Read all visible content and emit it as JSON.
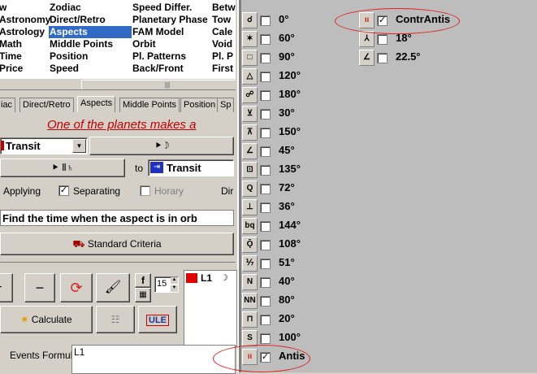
{
  "categories": {
    "col1": [
      "w",
      "Astronomy",
      "Astrology",
      "Math",
      "Time",
      "Price"
    ],
    "col2": [
      "Zodiac",
      "Direct/Retro",
      "Aspects",
      "Middle Points",
      "Position",
      "Speed"
    ],
    "col3": [
      "Speed Differ.",
      "Planetary Phase",
      "FAM Model",
      "Orbit",
      "Pl. Patterns",
      "Back/Front"
    ],
    "col4": [
      "Betw",
      "Tow",
      "Cale",
      "Void",
      "Pl. P",
      "First"
    ],
    "selected": "Aspects"
  },
  "tabs": [
    "iac",
    "Direct/Retro",
    "Aspects",
    "Middle Points",
    "Position",
    "Sp"
  ],
  "active_tab": "Aspects",
  "banner": "One of the planets makes a",
  "transit_left": "Transit",
  "planet_btn": "⯈ Ⅱ♄",
  "to_label": "to",
  "transit_right": "Transit",
  "moon_btn": "⯈☽",
  "options": {
    "applying": "Applying",
    "separating": "Separating",
    "horary": "Horary",
    "dir": "Dir"
  },
  "criteria_text": "Find the time when the aspect is in orb",
  "standard_criteria": "Standard Criteria",
  "spin_value": "15",
  "f_label": "f",
  "calculate_label": "Calculate",
  "ule_label": "ULE",
  "l1_label": "L1",
  "events_label": "Events Formula",
  "events_value": "L1",
  "aspects_left": [
    {
      "icon": "☌",
      "label": "0°",
      "checked": false
    },
    {
      "icon": "✶",
      "label": "60°",
      "checked": false
    },
    {
      "icon": "□",
      "label": "90°",
      "checked": false
    },
    {
      "icon": "△",
      "label": "120°",
      "checked": false
    },
    {
      "icon": "☍",
      "label": "180°",
      "checked": false
    },
    {
      "icon": "⊻",
      "label": "30°",
      "checked": false
    },
    {
      "icon": "⊼",
      "label": "150°",
      "checked": false
    },
    {
      "icon": "∠",
      "label": "45°",
      "checked": false
    },
    {
      "icon": "⊡",
      "label": "135°",
      "checked": false
    },
    {
      "icon": "Q",
      "label": "72°",
      "checked": false
    },
    {
      "icon": "⊥",
      "label": "36°",
      "checked": false
    },
    {
      "icon": "bq",
      "label": "144°",
      "checked": false
    },
    {
      "icon": "Ǭ",
      "label": "108°",
      "checked": false
    },
    {
      "icon": "⅐",
      "label": "51°",
      "checked": false
    },
    {
      "icon": "N",
      "label": "40°",
      "checked": false
    },
    {
      "icon": "NN",
      "label": "80°",
      "checked": false
    },
    {
      "icon": "⊓",
      "label": "20°",
      "checked": false
    },
    {
      "icon": "S",
      "label": "100°",
      "checked": false
    },
    {
      "icon": "ıı",
      "label": "Antis",
      "checked": true
    }
  ],
  "aspects_right": [
    {
      "icon": "ıı",
      "label": "ContrAntis",
      "checked": true
    },
    {
      "icon": "⅄",
      "label": "18°",
      "checked": false
    },
    {
      "icon": "∠",
      "label": "22.5°",
      "checked": false
    }
  ],
  "colors": {
    "selection": "#316ac5",
    "banner": "#c00000",
    "highlight": "#e02020",
    "panel": "#bdbdbd"
  }
}
